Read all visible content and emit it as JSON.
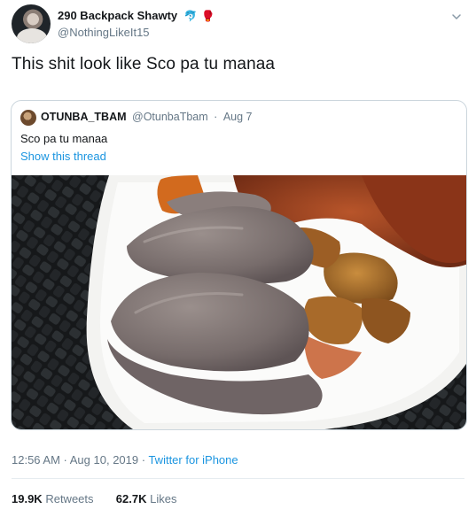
{
  "author": {
    "display_name": "290 Backpack Shawty",
    "emoji_1": "🐬",
    "emoji_2": "🥊",
    "handle": "@NothingLikeIt15"
  },
  "tweet": {
    "text": "This shit look like Sco pa tu manaa"
  },
  "quoted": {
    "name": "OTUNBA_TBAM",
    "handle": "@OtunbaTbam",
    "separator": "·",
    "date": "Aug 7",
    "text": "Sco pa tu manaa",
    "show_thread": "Show this thread"
  },
  "footer": {
    "time": "12:56 AM · Aug 10, 2019 ·",
    "source": "Twitter for iPhone"
  },
  "stats": {
    "retweets_count": "19.9K",
    "retweets_label": "Retweets",
    "likes_count": "62.7K",
    "likes_label": "Likes"
  },
  "icons": {
    "caret": "chevron-down-icon"
  },
  "colors": {
    "link": "#1b95e0",
    "muted": "#657786",
    "border": "#ccd6dd"
  }
}
